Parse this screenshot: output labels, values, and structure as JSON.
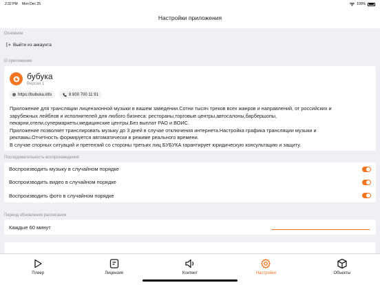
{
  "status_bar": {
    "time": "2:32 PM",
    "date": "Mon Dec 25",
    "battery": "100%"
  },
  "header": {
    "title": "Настройки приложения"
  },
  "sections": {
    "main": {
      "label": "Основное",
      "logout_label": "Выйти из аккаунта"
    },
    "about": {
      "label": "О приложении",
      "app_name": "бубука",
      "version": "Версия 1",
      "website": "https://bubuka.info",
      "phone": "8 800 700 11 91",
      "description": [
        "Приложение для трансляции лицензионной музыки в вашем заведении.Сотни тысяч треков  всех жанров и направлений, от российских и зарубежных лейблов и исполнителей для любого бизнеса: рестораны,торговые центры,автосалоны,барбершопы, пекарни,отели,супермаркеты,медицинские центры.Без выплат РАО и ВОИС.",
        "Приложение позволяет транслировать музыку до 3 дней в случае отключения интернета.Настройка графика трансляции музыки и рекламы.Отчетность формируется автоматически в режиме реального времени.",
        "В случае спорных ситуаций и претензий со стороны третьих лиц  БУБУКА гарантирует юридическую консультацию и защиту."
      ]
    },
    "shuffle": {
      "label": "Последовательность воспроизведения",
      "items": [
        {
          "label": "Воспроизводить музыку в случайном порядке",
          "enabled": true
        },
        {
          "label": "Воспроизводить видео в случайном порядке",
          "enabled": true
        },
        {
          "label": "Воспроизводить фото в случайном порядке",
          "enabled": true
        }
      ]
    },
    "schedule": {
      "label": "Период обновления расписания",
      "value": "Каждые 60 минут"
    }
  },
  "tabbar": [
    {
      "label": "Плеер",
      "icon": "play-icon",
      "active": false
    },
    {
      "label": "Лицензия",
      "icon": "license-icon",
      "active": false
    },
    {
      "label": "Контент",
      "icon": "speaker-icon",
      "active": false
    },
    {
      "label": "Настройки",
      "icon": "gear-icon",
      "active": true
    },
    {
      "label": "Объекты",
      "icon": "box-icon",
      "active": false
    }
  ],
  "colors": {
    "accent": "#f47521",
    "background": "#f0eff4"
  }
}
